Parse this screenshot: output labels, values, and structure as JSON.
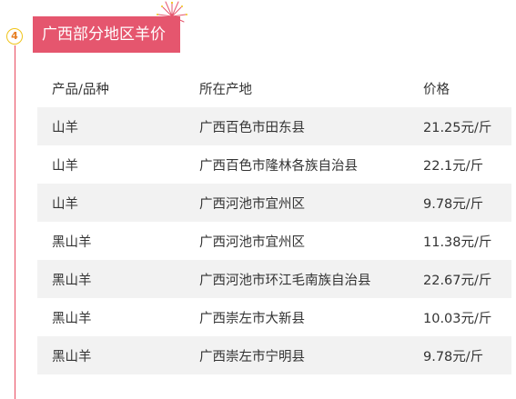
{
  "section": {
    "number": "4",
    "title": "广西部分地区羊价"
  },
  "table": {
    "headers": [
      "产品/品种",
      "所在产地",
      "价格"
    ],
    "rows": [
      [
        "山羊",
        "广西百色市田东县",
        "21.25元/斤"
      ],
      [
        "山羊",
        "广西百色市隆林各族自治县",
        "22.1元/斤"
      ],
      [
        "山羊",
        "广西河池市宜州区",
        "9.78元/斤"
      ],
      [
        "黑山羊",
        "广西河池市宜州区",
        "11.38元/斤"
      ],
      [
        "黑山羊",
        "广西河池市环江毛南族自治县",
        "22.67元/斤"
      ],
      [
        "黑山羊",
        "广西崇左市大新县",
        "10.03元/斤"
      ],
      [
        "黑山羊",
        "广西崇左市宁明县",
        "9.78元/斤"
      ]
    ]
  },
  "colors": {
    "accent": "#e5566e",
    "line": "#e84a5f",
    "badge_border": "#f0c419",
    "row_shade": "#f2f2f2"
  }
}
